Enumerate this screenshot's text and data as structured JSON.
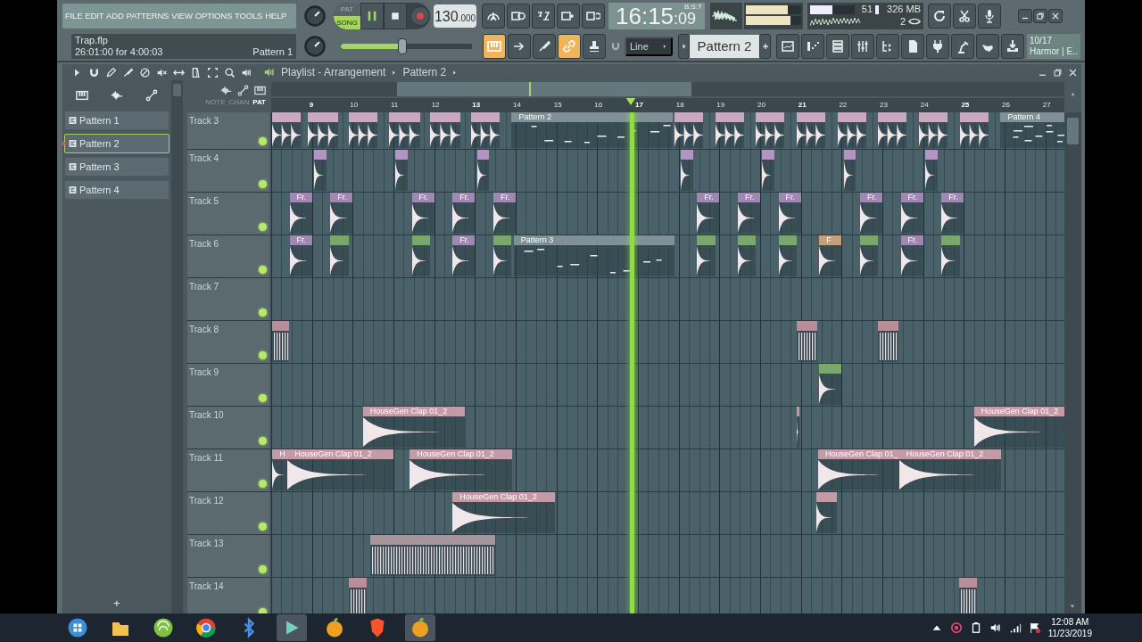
{
  "menu": [
    "FILE",
    "EDIT",
    "ADD",
    "PATTERNS",
    "VIEW",
    "OPTIONS",
    "TOOLS",
    "HELP"
  ],
  "transport": {
    "pat_label": "PAT",
    "song_label": "SONG",
    "song_selected": true,
    "playing": true,
    "tempo": "130",
    "tempo_decimals": ".000"
  },
  "clock": {
    "time": "16:15",
    "seconds": ":09",
    "format": "B:S:T"
  },
  "output_meters": [
    {
      "level": 0.76
    },
    {
      "level": 0.8
    }
  ],
  "monitor": {
    "cpu": {
      "reading": "51",
      "level": 0.5
    },
    "memory": "326 MB",
    "polyphony": "2"
  },
  "hint": {
    "file": "Trap.flp",
    "position": "26:01:00 for 4:00:03",
    "pattern": "Pattern 1"
  },
  "master_pitch": {
    "level": 0.47
  },
  "mode_buttons": [
    {
      "on": true
    },
    {
      "on": false
    },
    {
      "on": false
    },
    {
      "on": true
    },
    {
      "on": false
    }
  ],
  "toolbar": {
    "snap": "Line",
    "pattern": "Pattern 2",
    "plugin_count": "10/17",
    "plugin_name": "Harmor | E.."
  },
  "playlist": {
    "title": "Playlist - Arrangement",
    "pattern": "Pattern 2",
    "picker": [
      {
        "name": "Pattern 1",
        "selected": false
      },
      {
        "name": "Pattern 2",
        "selected": true
      },
      {
        "name": "Pattern 3",
        "selected": false
      },
      {
        "name": "Pattern 4",
        "selected": false
      }
    ],
    "add_label": "+",
    "filters": [
      {
        "label": "NOTE",
        "selected": false
      },
      {
        "label": "CHAN",
        "selected": false
      },
      {
        "label": "PAT",
        "selected": true
      }
    ],
    "ruler": [
      "9",
      "10",
      "11",
      "12",
      "13",
      "14",
      "15",
      "16",
      "17",
      "18",
      "19",
      "20",
      "21",
      "22",
      "23",
      "24",
      "25",
      "26",
      "27"
    ],
    "tracks": [
      {
        "name": "Track 3",
        "enabled": true,
        "clips": [
          {
            "kind": "drum",
            "color": "#c9a9c0"
          },
          {
            "kind": "drum",
            "color": "#c9a9c0"
          },
          {
            "kind": "drum",
            "color": "#c9a9c0"
          },
          {
            "kind": "drum",
            "color": "#c9a9c0"
          },
          {
            "kind": "drum",
            "color": "#c9a9c0"
          },
          {
            "kind": "drum",
            "color": "#c9a9c0"
          },
          {
            "kind": "pattern",
            "color": "#7f9196",
            "label": "Pattern 2"
          },
          {
            "kind": "drum",
            "color": "#c9a9c0"
          },
          {
            "kind": "drum",
            "color": "#c9a9c0"
          },
          {
            "kind": "drum",
            "color": "#c9a9c0"
          },
          {
            "kind": "drum",
            "color": "#c9a9c0"
          },
          {
            "kind": "drum",
            "color": "#c9a9c0"
          },
          {
            "kind": "drum",
            "color": "#c9a9c0"
          },
          {
            "kind": "drum",
            "color": "#c9a9c0"
          },
          {
            "kind": "drum",
            "color": "#c9a9c0"
          },
          {
            "kind": "pattern",
            "color": "#7f9196",
            "label": "Pattern 4"
          }
        ]
      },
      {
        "name": "Track 4",
        "enabled": true,
        "clips": [
          {
            "kind": "audio",
            "color": "#b395c4"
          },
          {
            "kind": "audio",
            "color": "#b395c4"
          },
          {
            "kind": "audio",
            "color": "#b395c4"
          },
          {
            "kind": "audio",
            "color": "#b395c4"
          },
          {
            "kind": "audio",
            "color": "#b395c4"
          },
          {
            "kind": "audio",
            "color": "#b395c4"
          },
          {
            "kind": "audio",
            "color": "#b395c4"
          }
        ]
      },
      {
        "name": "Track 5",
        "enabled": true,
        "clips": [
          {
            "kind": "audio",
            "color": "#9f89b3",
            "label": "Fr."
          },
          {
            "kind": "audio",
            "color": "#9f89b3",
            "label": "Fr."
          },
          {
            "kind": "audio",
            "color": "#9f89b3",
            "label": "Fr."
          },
          {
            "kind": "audio",
            "color": "#9f89b3",
            "label": "Fr."
          },
          {
            "kind": "audio",
            "color": "#9f89b3",
            "label": "Fr."
          },
          {
            "kind": "audio",
            "color": "#9f89b3",
            "label": "Fr."
          },
          {
            "kind": "audio",
            "color": "#9f89b3",
            "label": "Fr."
          },
          {
            "kind": "audio",
            "color": "#9f89b3",
            "label": "Fr."
          },
          {
            "kind": "audio",
            "color": "#9f89b3",
            "label": "Fr."
          },
          {
            "kind": "audio",
            "color": "#9f89b3",
            "label": "Fr."
          },
          {
            "kind": "audio",
            "color": "#9f89b3",
            "label": "Fr."
          }
        ]
      },
      {
        "name": "Track 6",
        "enabled": true,
        "clips": [
          {
            "kind": "audio",
            "color": "#9f89b3",
            "label": "Fr."
          },
          {
            "kind": "audio",
            "color": "#79a86c"
          },
          {
            "kind": "audio",
            "color": "#79a86c"
          },
          {
            "kind": "audio",
            "color": "#9f89b3",
            "label": "Fr."
          },
          {
            "kind": "audio",
            "color": "#79a86c"
          },
          {
            "kind": "pattern",
            "color": "#7f9196",
            "label": "Pattern 3"
          },
          {
            "kind": "audio",
            "color": "#79a86c"
          },
          {
            "kind": "audio",
            "color": "#79a86c"
          },
          {
            "kind": "audio",
            "color": "#79a86c"
          },
          {
            "kind": "audio",
            "color": "#c4a07c",
            "label": "F"
          },
          {
            "kind": "audio",
            "color": "#79a86c"
          },
          {
            "kind": "audio",
            "color": "#9f89b3",
            "label": "Fr."
          },
          {
            "kind": "audio",
            "color": "#79a86c"
          }
        ]
      },
      {
        "name": "Track 7",
        "enabled": true
      },
      {
        "name": "Track 8",
        "enabled": true,
        "clips": [
          {
            "kind": "hits",
            "color": "#b88e99"
          },
          {
            "kind": "hits",
            "color": "#b88e99"
          },
          {
            "kind": "hits",
            "color": "#b88e99"
          }
        ]
      },
      {
        "name": "Track 9",
        "enabled": true,
        "clips": [
          {
            "kind": "audio",
            "color": "#79a86c"
          }
        ]
      },
      {
        "name": "Track 10",
        "enabled": true,
        "clips": [
          {
            "kind": "audio",
            "color": "#c39ba6",
            "label": "HouseGen Clap 01_2"
          },
          {
            "kind": "audio",
            "color": "#c39ba6"
          },
          {
            "kind": "audio",
            "color": "#c39ba6",
            "label": "HouseGen Clap 01_2"
          }
        ]
      },
      {
        "name": "Track 11",
        "enabled": true,
        "clips": [
          {
            "kind": "audio",
            "color": "#c39ba6",
            "label": "H"
          },
          {
            "kind": "audio",
            "color": "#c39ba6",
            "label": "HouseGen Clap 01_2"
          },
          {
            "kind": "audio",
            "color": "#c39ba6",
            "label": "HouseGen Clap 01_2"
          },
          {
            "kind": "audio",
            "color": "#c39ba6",
            "label": "HouseGen Clap 01_"
          },
          {
            "kind": "audio",
            "color": "#c39ba6",
            "label": "HouseGen Clap 01_2"
          }
        ]
      },
      {
        "name": "Track 12",
        "enabled": true,
        "clips": [
          {
            "kind": "audio",
            "color": "#c39ba6",
            "label": "HouseGen Clap 01_2"
          },
          {
            "kind": "audio",
            "color": "#c39ba6"
          }
        ]
      },
      {
        "name": "Track 13",
        "enabled": true,
        "clips": [
          {
            "kind": "hits",
            "color": "#a5959d"
          }
        ]
      },
      {
        "name": "Track 14",
        "enabled": true,
        "clips": [
          {
            "kind": "hits",
            "color": "#b88e99"
          },
          {
            "kind": "hits",
            "color": "#b88e99"
          }
        ]
      }
    ]
  },
  "taskbar": {
    "time": "12:08 AM",
    "date": "11/23/2019"
  }
}
